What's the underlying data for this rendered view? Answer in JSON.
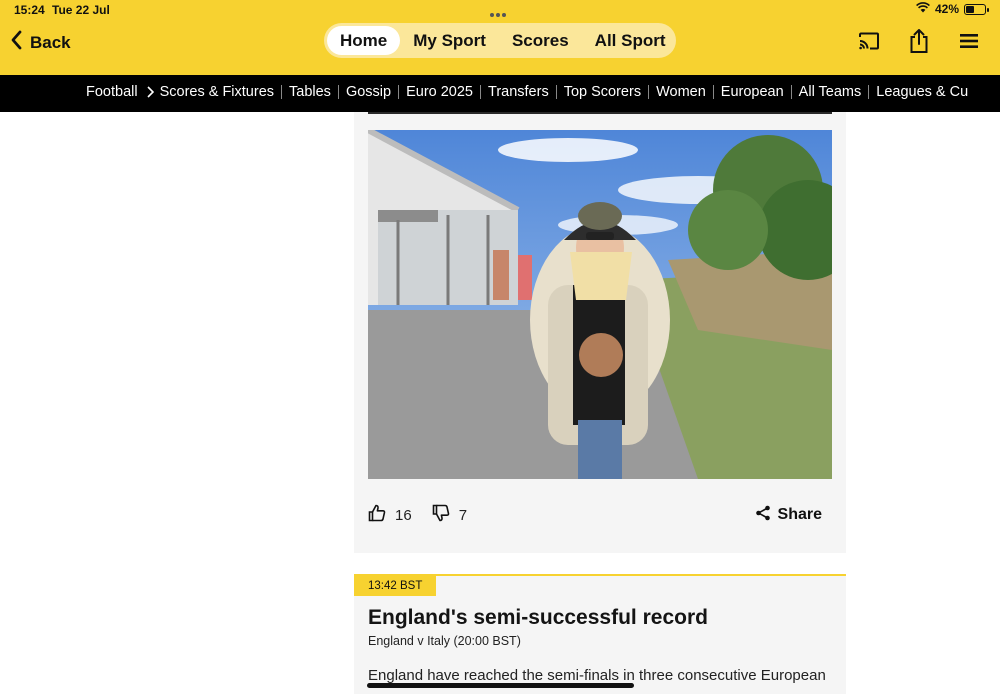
{
  "status_bar": {
    "time": "15:24",
    "date": "Tue 22 Jul",
    "battery": "42%",
    "battery_level": 0.42,
    "icons": [
      "wifi-icon",
      "battery-icon"
    ]
  },
  "header": {
    "back_label": "Back",
    "tabs": [
      {
        "label": "Home",
        "active": true
      },
      {
        "label": "My Sport",
        "active": false
      },
      {
        "label": "Scores",
        "active": false
      },
      {
        "label": "All Sport",
        "active": false
      }
    ],
    "icons": [
      "cast-icon",
      "share-upload-icon",
      "menu-icon"
    ],
    "color": "#f7d230"
  },
  "subnav": {
    "section": "Football",
    "items": [
      "Scores & Fixtures",
      "Tables",
      "Gossip",
      "Euro 2025",
      "Transfers",
      "Top Scorers",
      "Women",
      "European",
      "All Teams",
      "Leagues & Cu"
    ]
  },
  "post1": {
    "likes": "16",
    "dislikes": "7",
    "share_label": "Share"
  },
  "post2": {
    "time": "13:42 BST",
    "title": "England's semi-successful record",
    "subtitle": "England v Italy (20:00 BST)",
    "body": "England have reached the semi-finals in three consecutive European"
  }
}
